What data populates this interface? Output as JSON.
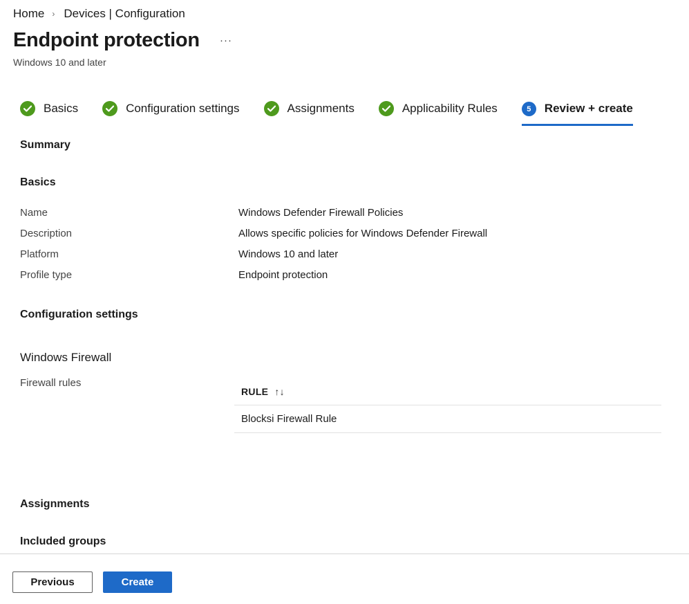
{
  "breadcrumb": {
    "home": "Home",
    "separator": "›",
    "current": "Devices | Configuration"
  },
  "page": {
    "title": "Endpoint protection",
    "more": "···",
    "subtitle": "Windows 10 and later"
  },
  "steps": [
    {
      "label": "Basics",
      "status": "complete"
    },
    {
      "label": "Configuration settings",
      "status": "complete"
    },
    {
      "label": "Assignments",
      "status": "complete"
    },
    {
      "label": "Applicability Rules",
      "status": "complete"
    },
    {
      "label": "Review + create",
      "status": "active",
      "number": "5"
    }
  ],
  "summary": {
    "heading": "Summary",
    "basics": {
      "heading": "Basics",
      "rows": [
        {
          "label": "Name",
          "value": "Windows Defender Firewall Policies"
        },
        {
          "label": "Description",
          "value": "Allows specific policies for Windows Defender Firewall"
        },
        {
          "label": "Platform",
          "value": "Windows 10 and later"
        },
        {
          "label": "Profile type",
          "value": "Endpoint protection"
        }
      ]
    },
    "config": {
      "heading": "Configuration settings",
      "subheading": "Windows Firewall",
      "firewall_rules_label": "Firewall rules",
      "table": {
        "column": "RULE",
        "sort_icon": "↑↓",
        "rows": [
          "Blocksi Firewall Rule"
        ]
      }
    },
    "assignments": {
      "heading": "Assignments",
      "included_groups": "Included groups"
    }
  },
  "footer": {
    "previous": "Previous",
    "create": "Create"
  },
  "colors": {
    "accent": "#1e6ac8",
    "complete": "#4e9a1d"
  }
}
